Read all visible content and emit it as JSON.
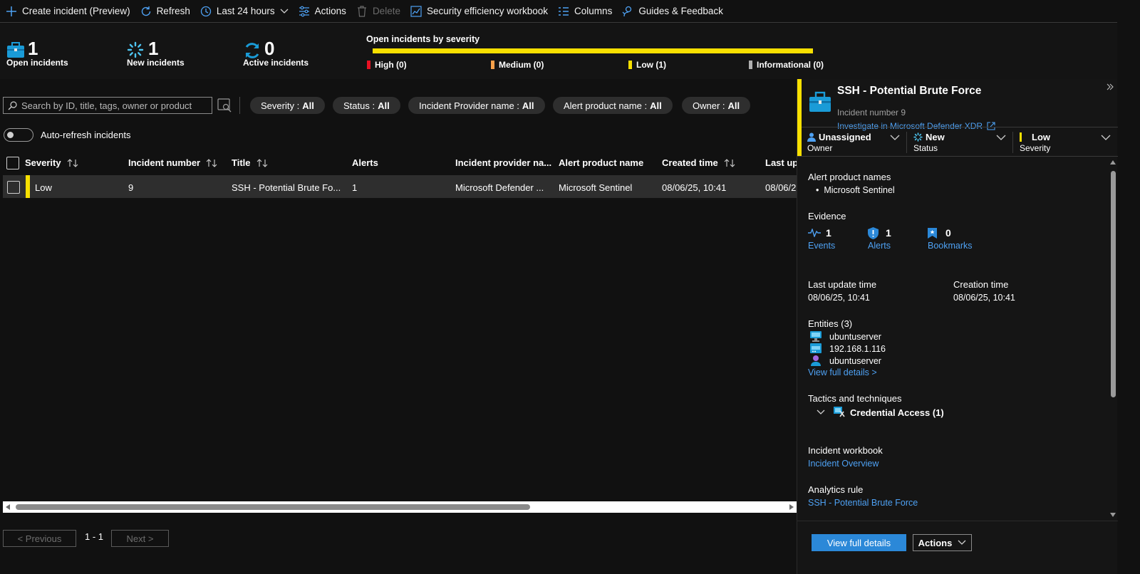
{
  "toolbar": {
    "create_label": "Create incident (Preview)",
    "refresh_label": "Refresh",
    "time_label": "Last 24 hours",
    "actions_label": "Actions",
    "delete_label": "Delete",
    "workbook_label": "Security efficiency workbook",
    "columns_label": "Columns",
    "guides_label": "Guides & Feedback"
  },
  "summary": {
    "open": {
      "count": "1",
      "label": "Open incidents"
    },
    "new": {
      "count": "1",
      "label": "New incidents"
    },
    "active": {
      "count": "0",
      "label": "Active incidents"
    },
    "severity_title": "Open incidents by severity",
    "severity_fill_fraction": 1.0,
    "severity_legend": {
      "high": "High (0)",
      "medium": "Medium (0)",
      "low": "Low (1)",
      "informational": "Informational (0)"
    },
    "colors": {
      "high": "#e81123",
      "medium": "#f7a14a",
      "low": "#f8e000",
      "informational": "#b0b0b0"
    }
  },
  "search": {
    "placeholder": "Search by ID, title, tags, owner or product"
  },
  "filters": {
    "severity": {
      "label": "Severity :",
      "value": "All"
    },
    "status": {
      "label": "Status :",
      "value": "All"
    },
    "provider": {
      "label": "Incident Provider name :",
      "value": "All"
    },
    "product": {
      "label": "Alert product name :",
      "value": "All"
    },
    "owner": {
      "label": "Owner :",
      "value": "All"
    }
  },
  "auto_refresh_label": "Auto-refresh incidents",
  "table": {
    "headers": {
      "severity": "Severity",
      "number": "Incident number",
      "title": "Title",
      "alerts": "Alerts",
      "provider": "Incident provider na...",
      "product": "Alert product name",
      "created": "Created time",
      "last_update": "Last upd"
    },
    "rows": [
      {
        "severity": "Low",
        "number": "9",
        "title": "SSH - Potential Brute Fo...",
        "alerts": "1",
        "provider": "Microsoft Defender ...",
        "product": "Microsoft Sentinel",
        "created": "08/06/25, 10:41",
        "last_update": "08/06/2"
      }
    ]
  },
  "pager": {
    "previous": "< Previous",
    "range": "1 - 1",
    "next": "Next >"
  },
  "details": {
    "title": "SSH - Potential Brute Force",
    "incident_number": "Incident number 9",
    "investigate_link": "Investigate in Microsoft Defender XDR",
    "owner": {
      "value": "Unassigned",
      "label": "Owner"
    },
    "status": {
      "value": "New",
      "label": "Status"
    },
    "severity": {
      "value": "Low",
      "label": "Severity"
    },
    "alert_products_heading": "Alert product names",
    "alert_products": [
      "Microsoft Sentinel"
    ],
    "evidence_heading": "Evidence",
    "evidence": {
      "events": {
        "count": "1",
        "label": "Events"
      },
      "alerts": {
        "count": "1",
        "label": "Alerts"
      },
      "bookmarks": {
        "count": "0",
        "label": "Bookmarks"
      }
    },
    "last_update_label": "Last update time",
    "last_update_value": "08/06/25, 10:41",
    "creation_label": "Creation time",
    "creation_value": "08/06/25, 10:41",
    "entities_heading": "Entities (3)",
    "entities": [
      "ubuntuserver",
      "192.168.1.116",
      "ubuntuserver"
    ],
    "view_full_details_link": "View full details >",
    "tactics_heading": "Tactics and techniques",
    "tactic": "Credential Access (1)",
    "workbook_heading": "Incident workbook",
    "workbook_link": "Incident Overview",
    "rule_heading": "Analytics rule",
    "rule_link": "SSH - Potential Brute Force",
    "view_full_details_button": "View full details",
    "actions_button": "Actions"
  }
}
